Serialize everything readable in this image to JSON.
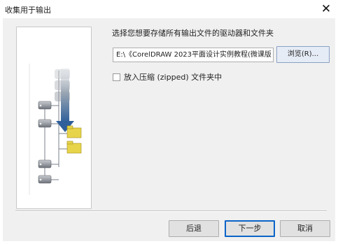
{
  "window": {
    "title": "收集用于输出",
    "close_glyph": "✕"
  },
  "main": {
    "instruction": "选择您想要存储所有输出文件的驱动器和文件夹",
    "path_value": "E:\\《CorelDRAW 2023平面设计实例教程(微课版",
    "browse_label": "浏览(R)...",
    "zip_label": "放入压缩 (zipped) 文件夹中",
    "zip_checked": false
  },
  "footer": {
    "back_label": "后退",
    "next_label": "下一步",
    "cancel_label": "取消"
  },
  "illustration": {
    "icons": [
      "disk-drive-icon",
      "folder-icon",
      "download-arrow-icon"
    ],
    "colors": {
      "folder": "#e8d44a",
      "arrow": "#2f5f9a",
      "drive": "#8a8f97",
      "tree_line": "#7a8088"
    }
  }
}
